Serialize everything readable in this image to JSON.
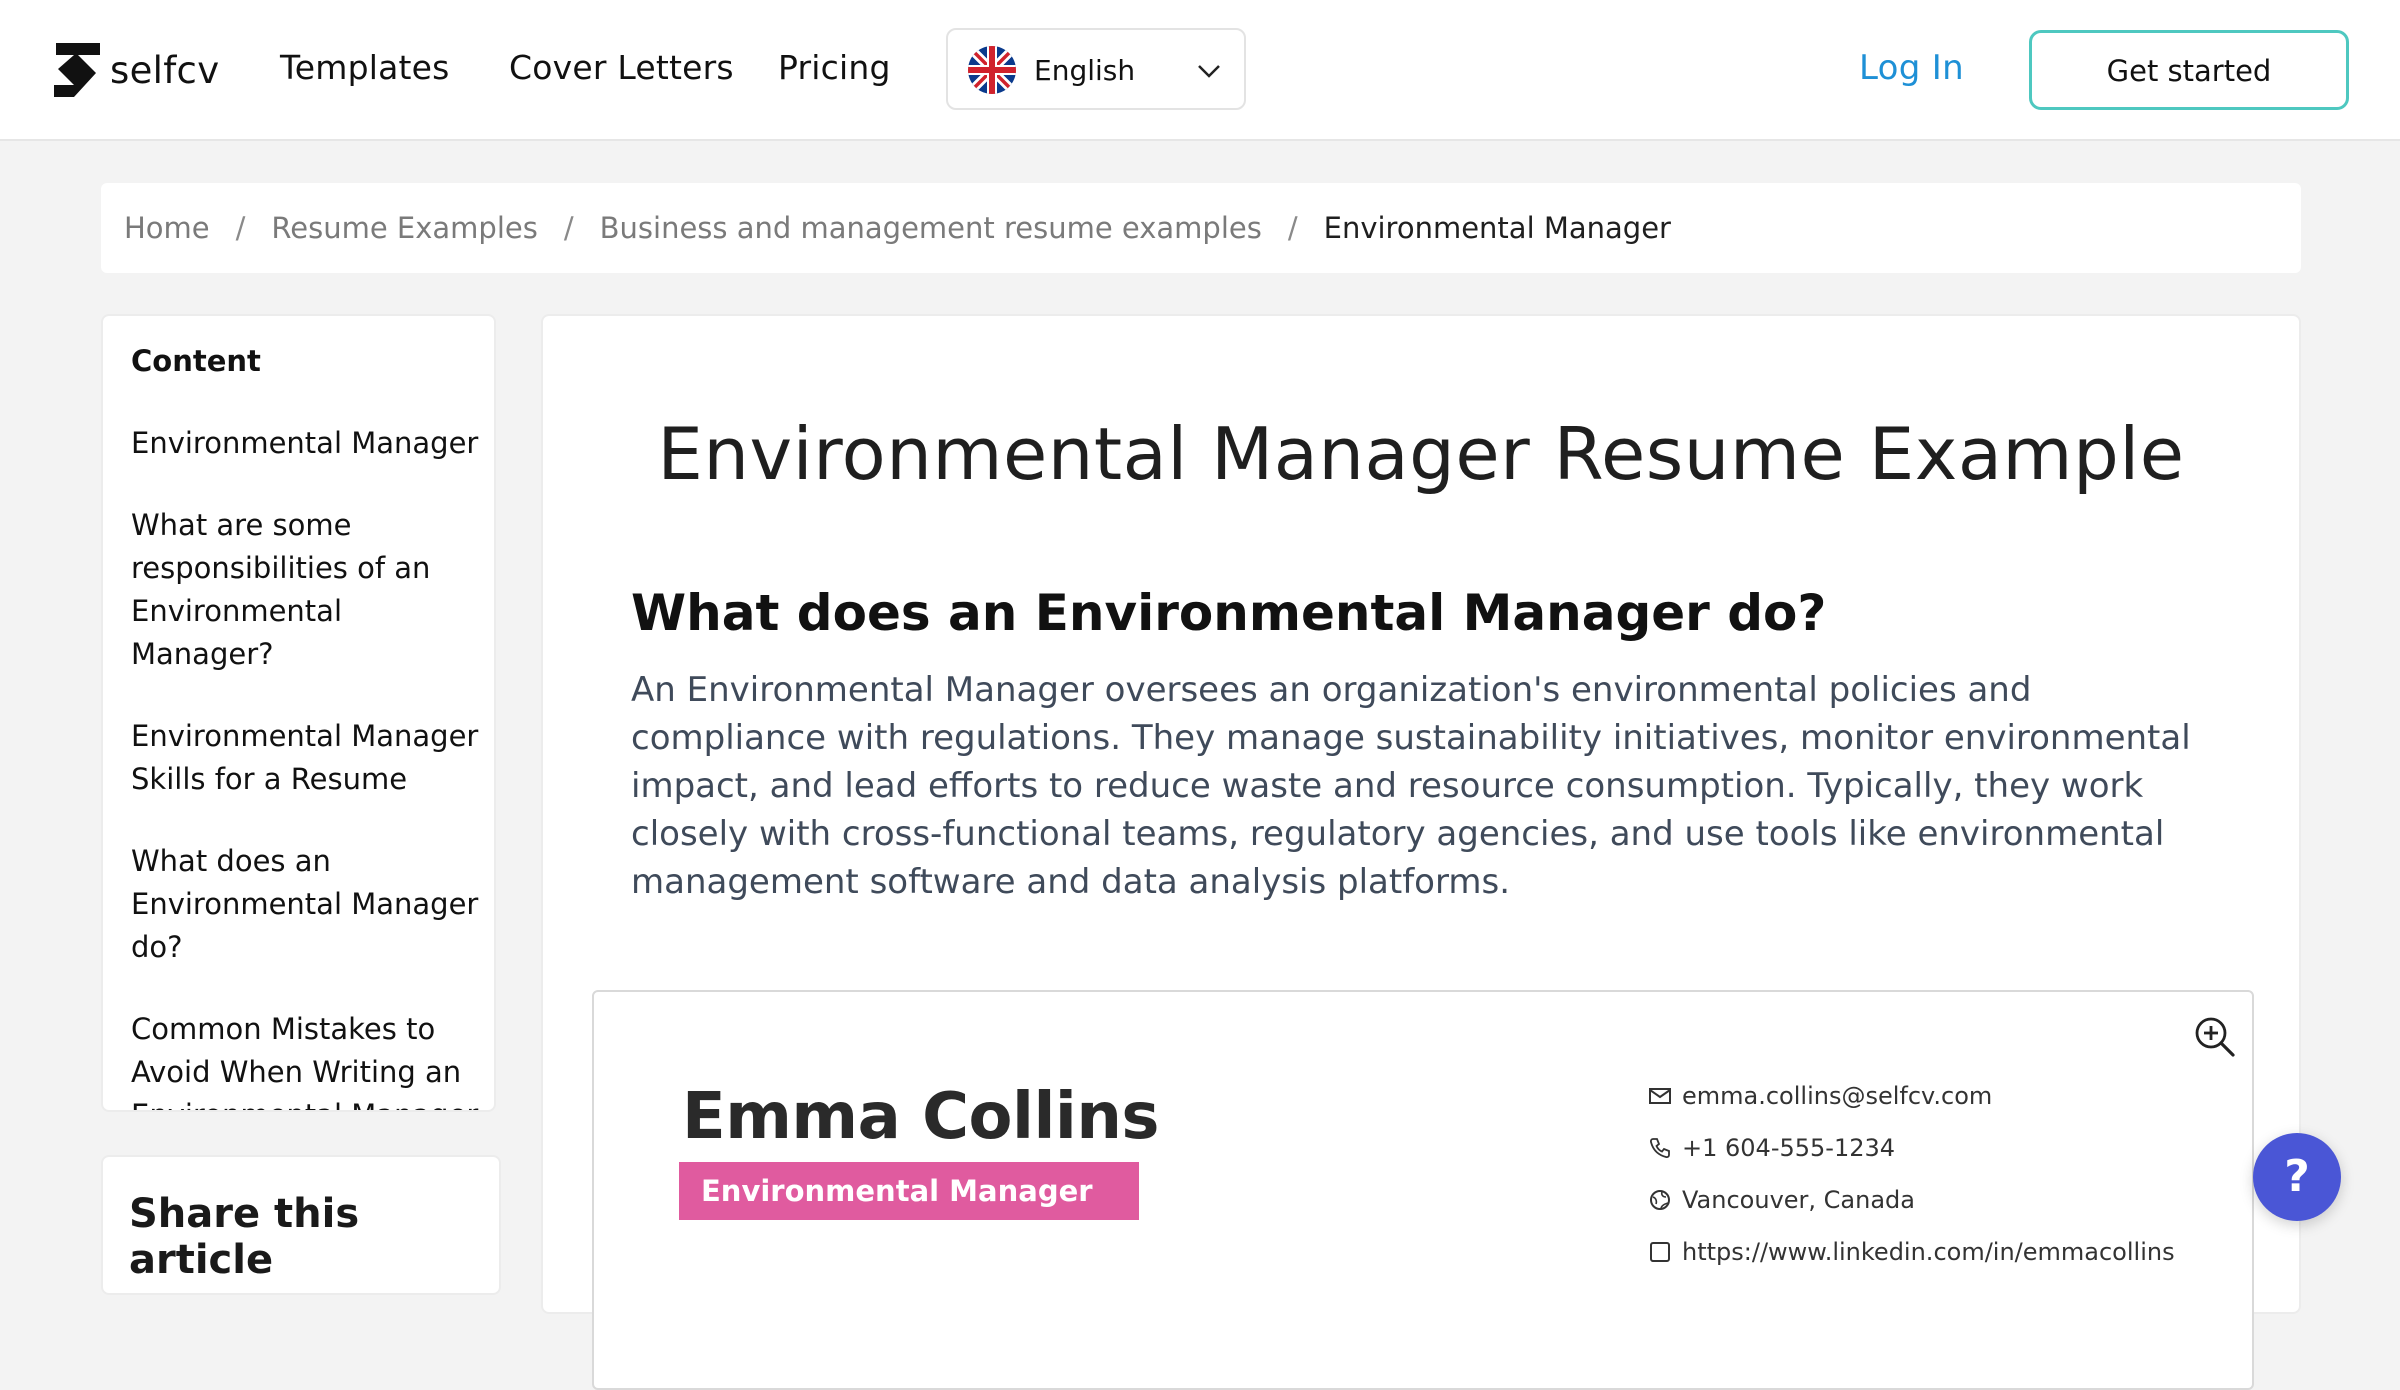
{
  "header": {
    "logo_text": "selfcv",
    "nav": [
      "Templates",
      "Cover Letters",
      "Pricing"
    ],
    "language": "English",
    "login": "Log In",
    "cta": "Get started"
  },
  "breadcrumb": [
    "Home",
    "Resume Examples",
    "Business and management resume examples",
    "Environmental Manager"
  ],
  "toc": {
    "title": "Content",
    "items": [
      "Environmental Manager",
      "What are some responsibilities of an Environmental Manager?",
      "Environmental Manager Skills for a Resume",
      "What does an Environmental Manager do?",
      "Common Mistakes to Avoid When Writing an Environmental Manager"
    ]
  },
  "share": {
    "title": "Share this article"
  },
  "article": {
    "title": "Environmental Manager Resume Example",
    "section_heading": "What does an Environmental Manager do?",
    "paragraph": "An Environmental Manager oversees an organization's environmental policies and compliance with regulations. They manage sustainability initiatives, monitor environmental impact, and lead efforts to reduce waste and resource consumption. Typically, they work closely with cross-functional teams, regulatory agencies, and use tools like environmental management software and data analysis platforms."
  },
  "resume": {
    "name": "Emma Collins",
    "role": "Environmental Manager",
    "email": "emma.collins@selfcv.com",
    "phone": "+1 604-555-1234",
    "location": "Vancouver, Canada",
    "linkedin": "https://www.linkedin.com/in/emmacollins"
  },
  "help": {
    "label": "?"
  },
  "colors": {
    "accent_teal": "#4ec8c0",
    "link_blue": "#1e90d6",
    "resume_pink": "#e05b9f",
    "help_blue": "#4a56d6"
  }
}
